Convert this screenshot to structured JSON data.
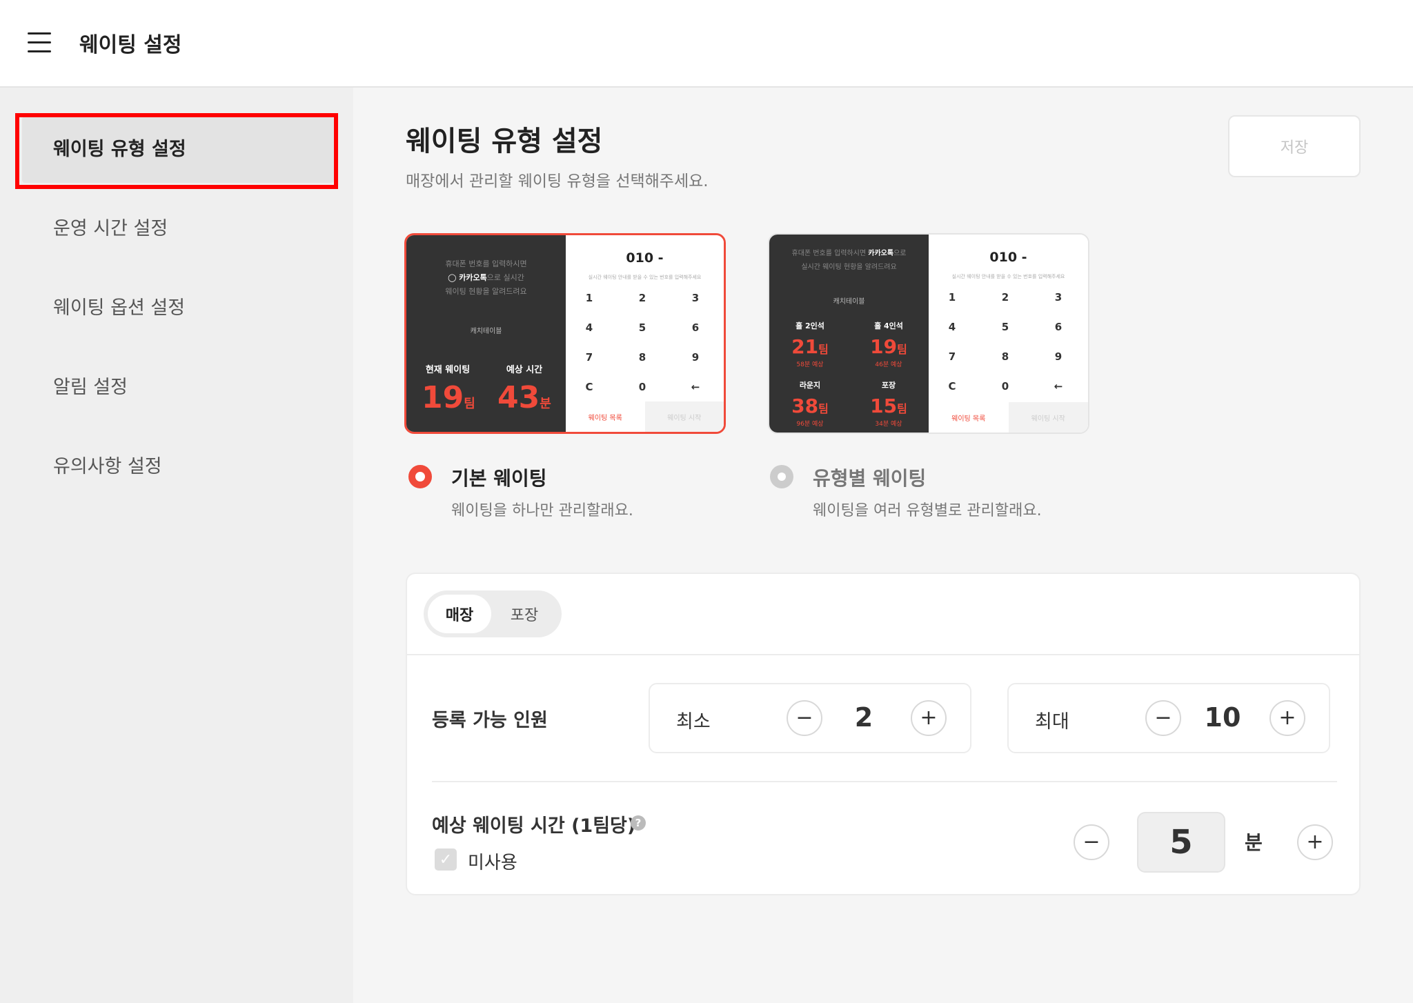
{
  "header": {
    "title": "웨이팅 설정"
  },
  "sidebar": {
    "items": [
      {
        "label": "웨이팅 유형 설정"
      },
      {
        "label": "운영 시간 설정"
      },
      {
        "label": "웨이팅 옵션 설정"
      },
      {
        "label": "알림 설정"
      },
      {
        "label": "유의사항 설정"
      }
    ]
  },
  "main": {
    "title": "웨이팅 유형 설정",
    "subtitle": "매장에서 관리할 웨이팅 유형을 선택해주세요.",
    "save_label": "저장"
  },
  "options": [
    {
      "title": "기본 웨이팅",
      "desc": "웨이팅을 하나만 관리할래요.",
      "selected": true,
      "preview": {
        "note1": "휴대폰 번호를 입력하시면",
        "note2_brand": "카카오톡",
        "note2_rest": "으로 실시간",
        "note3": "웨이팅 현황을 알려드려요",
        "store": "캐치테이블",
        "label_waiting": "현재 웨이팅",
        "label_time": "예상 시간",
        "waiting_value": "19",
        "waiting_unit": "팀",
        "time_value": "43",
        "time_unit": "분"
      }
    },
    {
      "title": "유형별 웨이팅",
      "desc": "웨이팅을 여러 유형별로 관리할래요.",
      "selected": false,
      "preview": {
        "note1_pre": "휴대폰 번호를 입력하시면 ",
        "note1_brand": "카카오톡",
        "note1_post": "으로",
        "note2": "실시간 웨이팅 현황을 알려드려요",
        "store": "캐치테이블",
        "cells": [
          {
            "name": "홀 2인석",
            "value": "21",
            "unit": "팀",
            "eta": "58분 예상"
          },
          {
            "name": "홀 4인석",
            "value": "19",
            "unit": "팀",
            "eta": "46분 예상"
          },
          {
            "name": "라운지",
            "value": "38",
            "unit": "팀",
            "eta": "96분 예상"
          },
          {
            "name": "포장",
            "value": "15",
            "unit": "팀",
            "eta": "34분 예상"
          }
        ]
      }
    }
  ],
  "keypad": {
    "phone": "010 -",
    "phone_sub": "실시간 웨이팅 안내를 받을 수 있는 번호를 입력해주세요",
    "keys": [
      "1",
      "2",
      "3",
      "4",
      "5",
      "6",
      "7",
      "8",
      "9",
      "C",
      "0",
      "←"
    ],
    "list_label": "웨이팅 목록",
    "start_label": "웨이팅 시작"
  },
  "settings": {
    "tabs": [
      {
        "label": "매장",
        "active": true
      },
      {
        "label": "포장",
        "active": false
      }
    ],
    "capacity": {
      "label": "등록 가능 인원",
      "min_label": "최소",
      "min_value": "2",
      "max_label": "최대",
      "max_value": "10"
    },
    "wait_time": {
      "label": "예상 웨이팅 시간 (1팀당)",
      "help": "?",
      "unused_label": "미사용",
      "unused_checked": true,
      "value": "5",
      "unit": "분"
    },
    "minus": "−",
    "plus": "+"
  },
  "colors": {
    "accent": "#f04a3a",
    "dark": "#333333"
  },
  "icons": [
    "menu-icon",
    "radio-icon",
    "minus-icon",
    "plus-icon",
    "help-icon",
    "check-icon",
    "backspace-icon"
  ]
}
